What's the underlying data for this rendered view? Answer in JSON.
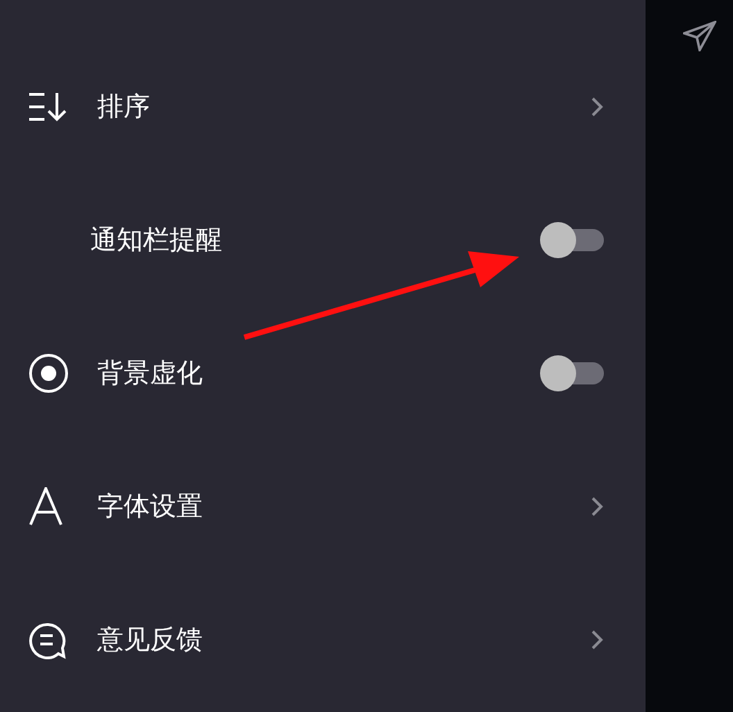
{
  "menu": [
    {
      "kind": "link",
      "label": "排序"
    },
    {
      "kind": "toggle",
      "label": "通知栏提醒",
      "on": false
    },
    {
      "kind": "toggle",
      "label": "背景虚化",
      "on": false
    },
    {
      "kind": "link",
      "label": "字体设置"
    },
    {
      "kind": "link",
      "label": "意见反馈"
    }
  ]
}
